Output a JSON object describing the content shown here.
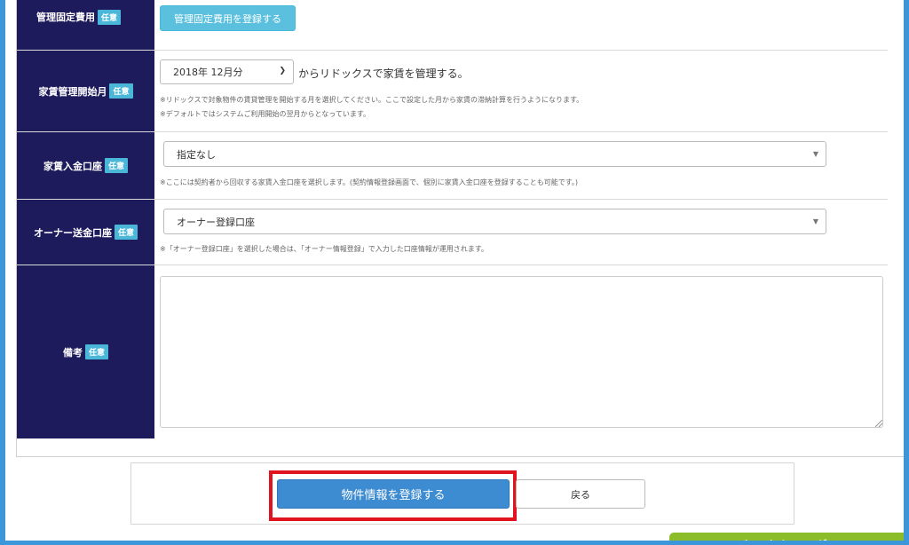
{
  "form": {
    "mgmt_fixed_cost": {
      "label": "管理固定費用",
      "badge": "任意",
      "button": "管理固定費用を登録する"
    },
    "rent_start_month": {
      "label": "家賃管理開始月",
      "badge": "任意",
      "selected": "2018年 12月分",
      "suffix": "からリドックスで家賃を管理する。",
      "note1": "※リドックスで対象物件の賃貸管理を開始する月を選択してください。ここで設定した月から家賃の滞納計算を行うようになります。",
      "note2": "※デフォルトではシステムご利用開始の翌月からとなっています。"
    },
    "rent_deposit_account": {
      "label": "家賃入金口座",
      "badge": "任意",
      "selected": "指定なし",
      "note": "※ここには契約者から回収する家賃入金口座を選択します。(契約情報登録画面で、個別に家賃入金口座を登録することも可能です。)"
    },
    "owner_remit_account": {
      "label": "オーナー送金口座",
      "badge": "任意",
      "selected": "オーナー登録口座",
      "note": "※「オーナー登録口座」を選択した場合は、「オーナー情報登録」で入力した口座情報が運用されます。"
    },
    "remarks": {
      "label": "備考",
      "badge": "任意",
      "value": ""
    }
  },
  "actions": {
    "register_label": "物件情報を登録する",
    "back_label": "戻る"
  },
  "floating_tab": {
    "label": "タスクカレンダー"
  },
  "colors": {
    "label_bg": "#1e1b5c",
    "badge": "#4ab7d9",
    "primary": "#3d8bd0",
    "highlight": "#e0141e",
    "frame": "#3b97d9",
    "task_tab": "#8bbd2a"
  }
}
